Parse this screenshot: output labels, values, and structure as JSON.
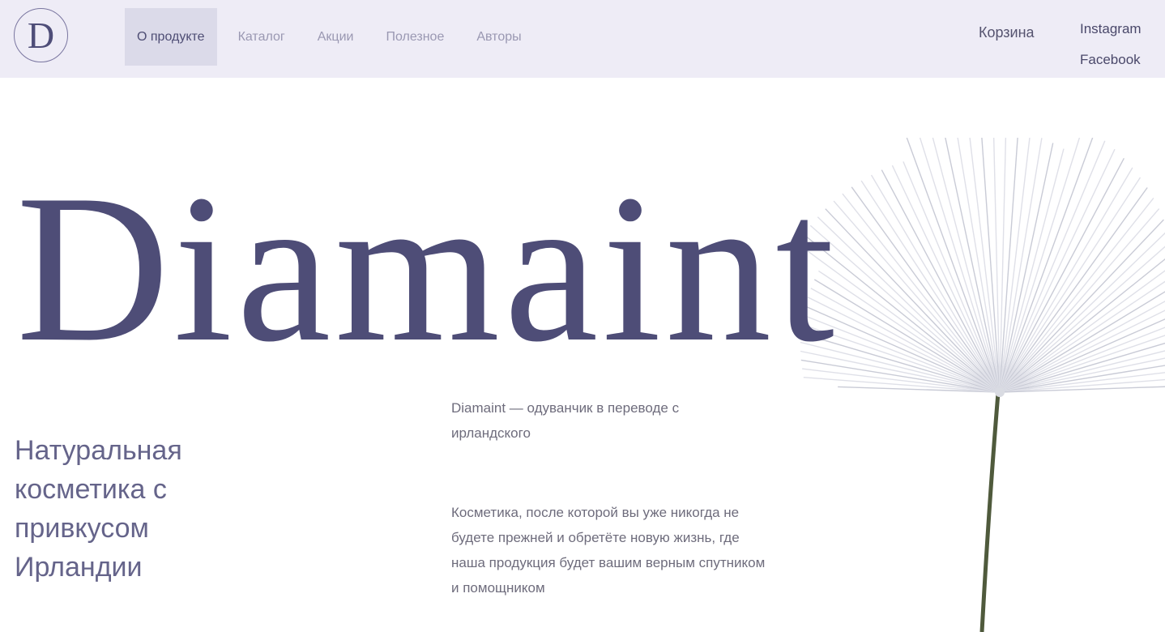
{
  "header": {
    "logo_letter": "D",
    "nav": [
      {
        "label": "О продукте",
        "active": true
      },
      {
        "label": "Каталог",
        "active": false
      },
      {
        "label": "Акции",
        "active": false
      },
      {
        "label": "Полезное",
        "active": false
      },
      {
        "label": "Авторы",
        "active": false
      }
    ],
    "cart_label": "Корзина",
    "social": [
      "Instagram",
      "Facebook"
    ]
  },
  "hero": {
    "brand": "Diamaint",
    "tagline": "Натуральная косметика с привкусом Ирландии",
    "description_1": "Diamaint — одуванчик в переводе с ирландского",
    "description_2": "Косметика, после которой вы уже никогда не будете прежней и обретёте новую жизнь, где наша продукция будет вашим верным спутником и помощником"
  },
  "colors": {
    "header_bg": "#eeecf6",
    "accent": "#4e4d77",
    "active_nav_bg": "#dbdae9"
  }
}
